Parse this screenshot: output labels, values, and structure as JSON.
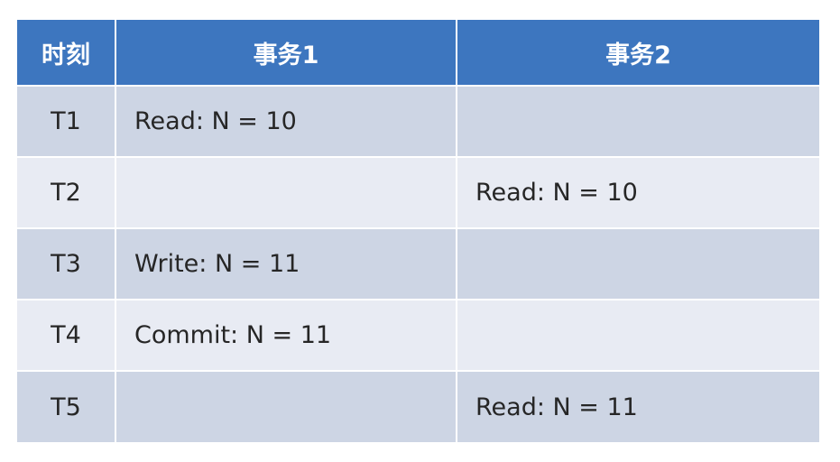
{
  "table": {
    "headers": [
      "时刻",
      "事务1",
      "事务2"
    ],
    "rows": [
      {
        "time": "T1",
        "tx1": "Read: N = 10",
        "tx2": ""
      },
      {
        "time": "T2",
        "tx1": "",
        "tx2": "Read: N = 10"
      },
      {
        "time": "T3",
        "tx1": "Write: N = 11",
        "tx2": ""
      },
      {
        "time": "T4",
        "tx1": "Commit: N = 11",
        "tx2": ""
      },
      {
        "time": "T5",
        "tx1": "",
        "tx2": "Read: N = 11"
      }
    ]
  },
  "colors": {
    "header_bg": "#3d76bf",
    "row_dark": "#cdd5e4",
    "row_light": "#e8ebf3",
    "text": "#262626"
  }
}
